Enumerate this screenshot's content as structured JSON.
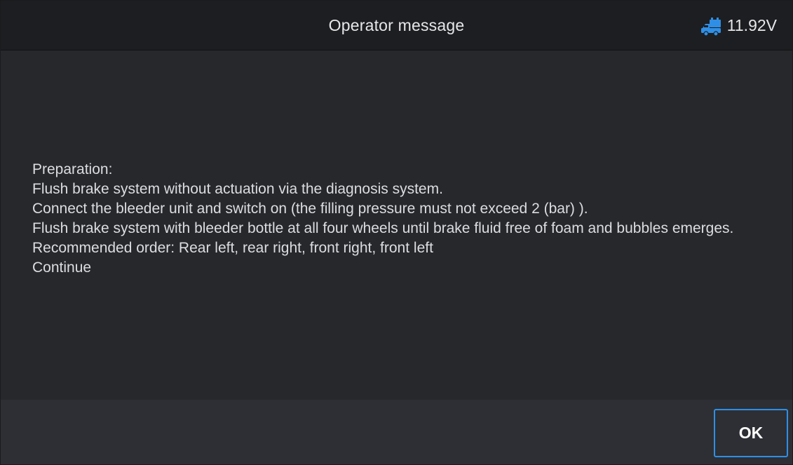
{
  "header": {
    "title": "Operator message",
    "battery_icon": "car-battery-icon",
    "battery_voltage": "11.92V"
  },
  "message": {
    "lines": [
      "Preparation:",
      "Flush brake system without actuation via the diagnosis system.",
      "Connect the bleeder unit and switch on (the filling pressure must not exceed 2  (bar) ).",
      "Flush brake system with bleeder bottle at all four wheels until brake fluid free of foam and bubbles emerges.",
      "Recommended order: Rear left, rear right, front right, front left",
      "Continue"
    ]
  },
  "footer": {
    "ok_label": "OK"
  },
  "colors": {
    "accent": "#2f8fe6",
    "background": "#26282c",
    "header_background": "#1d1e21",
    "footer_background": "#2d2f34",
    "text": "#dcdde0"
  }
}
